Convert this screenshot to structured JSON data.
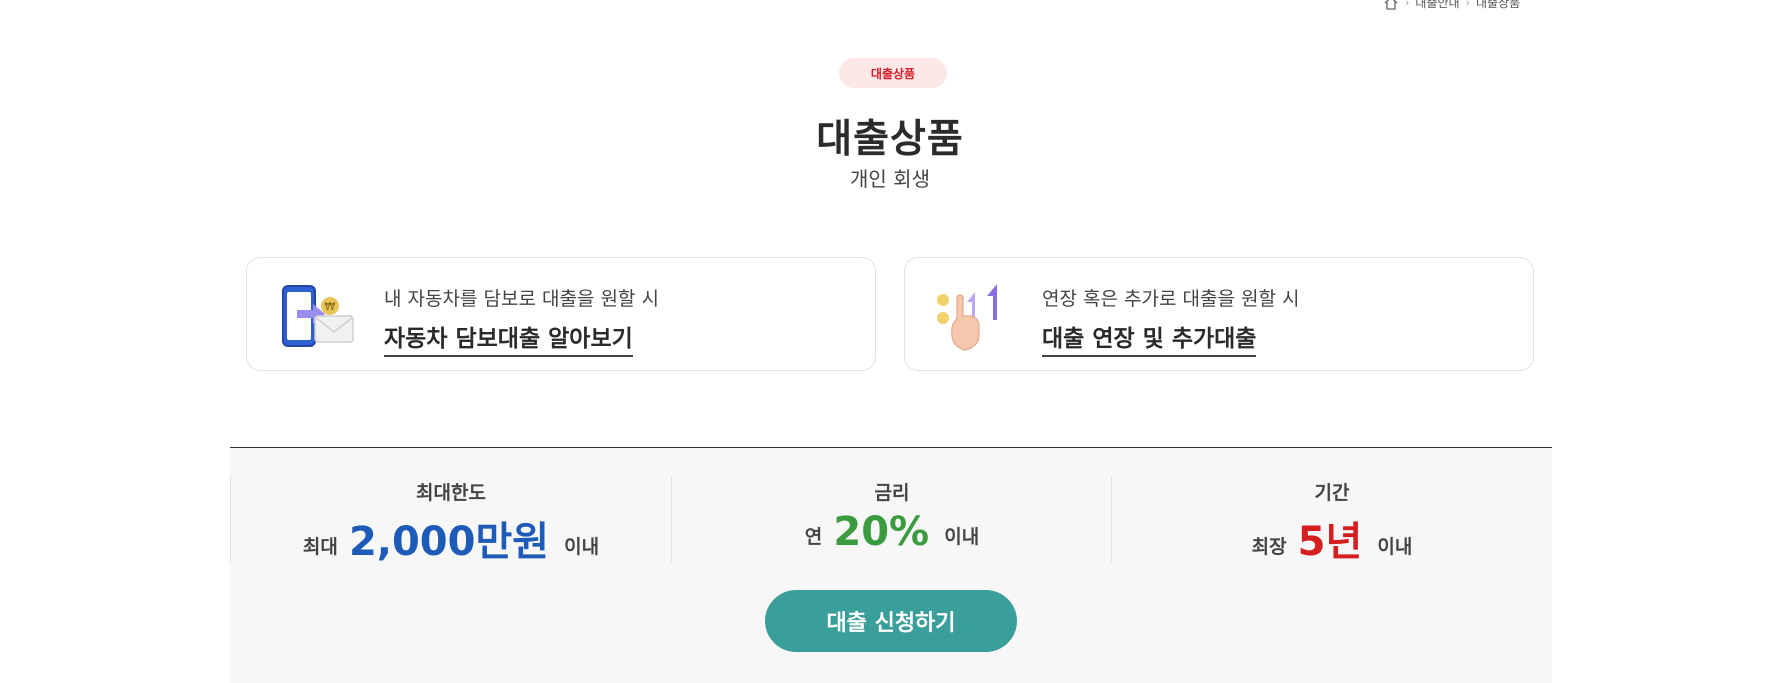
{
  "breadcrumb": {
    "home_icon": "home-icon",
    "items": [
      "대출안내",
      "대출상품"
    ]
  },
  "header": {
    "badge": "대출상품",
    "title": "대출상품",
    "subtitle": "개인 회생"
  },
  "cards": [
    {
      "description": "내 자동차를 담보로 대출을 원할 시",
      "link_text": "자동차 담보대출 알아보기",
      "icon": "phone-transfer-icon"
    },
    {
      "description": "연장 혹은 추가로 대출을 원할 시",
      "link_text": "대출 연장 및 추가대출",
      "icon": "hand-arrow-up-icon"
    }
  ],
  "info": [
    {
      "label": "최대한도",
      "prefix": "최대",
      "value": "2,000만원",
      "suffix": "이내",
      "color": "#1e5bb8"
    },
    {
      "label": "금리",
      "prefix": "연",
      "value": "20%",
      "suffix": "이내",
      "color": "#3a9c3e"
    },
    {
      "label": "기간",
      "prefix": "최장",
      "value": "5년",
      "suffix": "이내",
      "color": "#d61e1e"
    }
  ],
  "apply_button": "대출 신청하기",
  "colors": {
    "badge_bg": "#fde8e8",
    "badge_text": "#d6202d",
    "button": "#3a9e9a",
    "panel_bg": "#f7f7f7"
  }
}
